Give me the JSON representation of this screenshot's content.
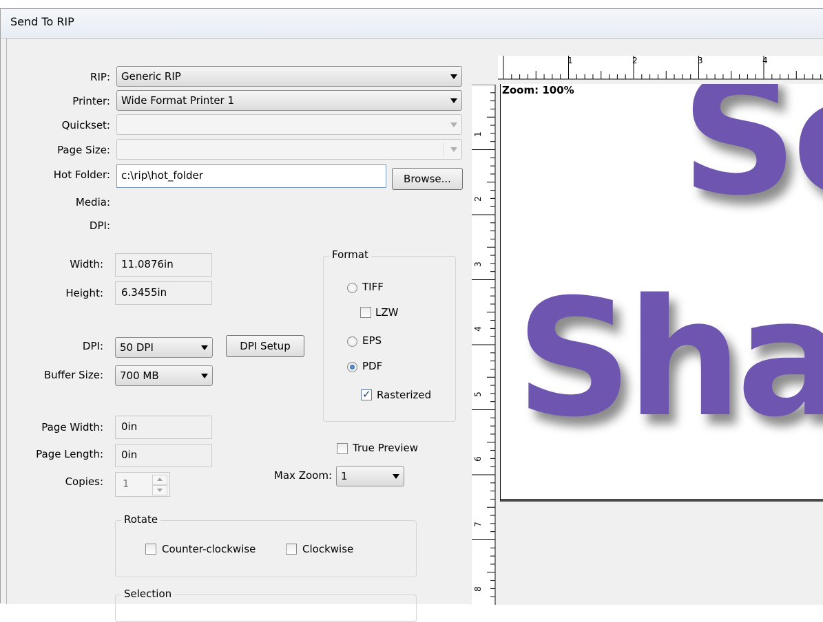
{
  "window": {
    "title": "Send To RIP"
  },
  "form": {
    "rip": {
      "label": "RIP:",
      "value": "Generic RIP"
    },
    "printer": {
      "label": "Printer:",
      "value": "Wide Format Printer 1"
    },
    "quickset": {
      "label": "Quickset:",
      "value": ""
    },
    "page_size": {
      "label": "Page Size:",
      "value": ""
    },
    "hot_folder": {
      "label": "Hot Folder:",
      "value": "c:\\rip\\hot_folder",
      "browse_label": "Browse..."
    },
    "media": {
      "label": "Media:"
    },
    "dpi_info": {
      "label": "DPI:"
    },
    "width": {
      "label": "Width:",
      "value": "11.0876in"
    },
    "height": {
      "label": "Height:",
      "value": "6.3455in"
    },
    "dpi": {
      "label": "DPI:",
      "value": "50 DPI",
      "setup_label": "DPI Setup"
    },
    "buffer_size": {
      "label": "Buffer Size:",
      "value": "700 MB"
    },
    "page_width": {
      "label": "Page Width:",
      "value": "0in"
    },
    "page_length": {
      "label": "Page Length:",
      "value": "0in"
    },
    "copies": {
      "label": "Copies:",
      "value": "1"
    }
  },
  "format": {
    "title": "Format",
    "tiff": {
      "label": "TIFF",
      "selected": false
    },
    "lzw": {
      "label": "LZW",
      "checked": false
    },
    "eps": {
      "label": "EPS",
      "selected": false
    },
    "pdf": {
      "label": "PDF",
      "selected": true
    },
    "rasterized": {
      "label": "Rasterized",
      "checked": true
    }
  },
  "true_preview": {
    "label": "True Preview",
    "checked": false
  },
  "max_zoom": {
    "label": "Max Zoom:",
    "value": "1"
  },
  "rotate": {
    "title": "Rotate",
    "counter_clockwise": {
      "label": "Counter-clockwise",
      "checked": false
    },
    "clockwise": {
      "label": "Clockwise",
      "checked": false
    }
  },
  "selection": {
    "title": "Selection"
  },
  "preview": {
    "zoom_text": "Zoom: 100%",
    "art_line1": "Sc",
    "art_line2": "Sha",
    "art_color": "#6e56b0",
    "ruler_top_labels": [
      "1",
      "2",
      "3",
      "4"
    ],
    "ruler_left_labels": [
      "1",
      "2",
      "3",
      "4",
      "5",
      "6",
      "7",
      "8"
    ]
  }
}
